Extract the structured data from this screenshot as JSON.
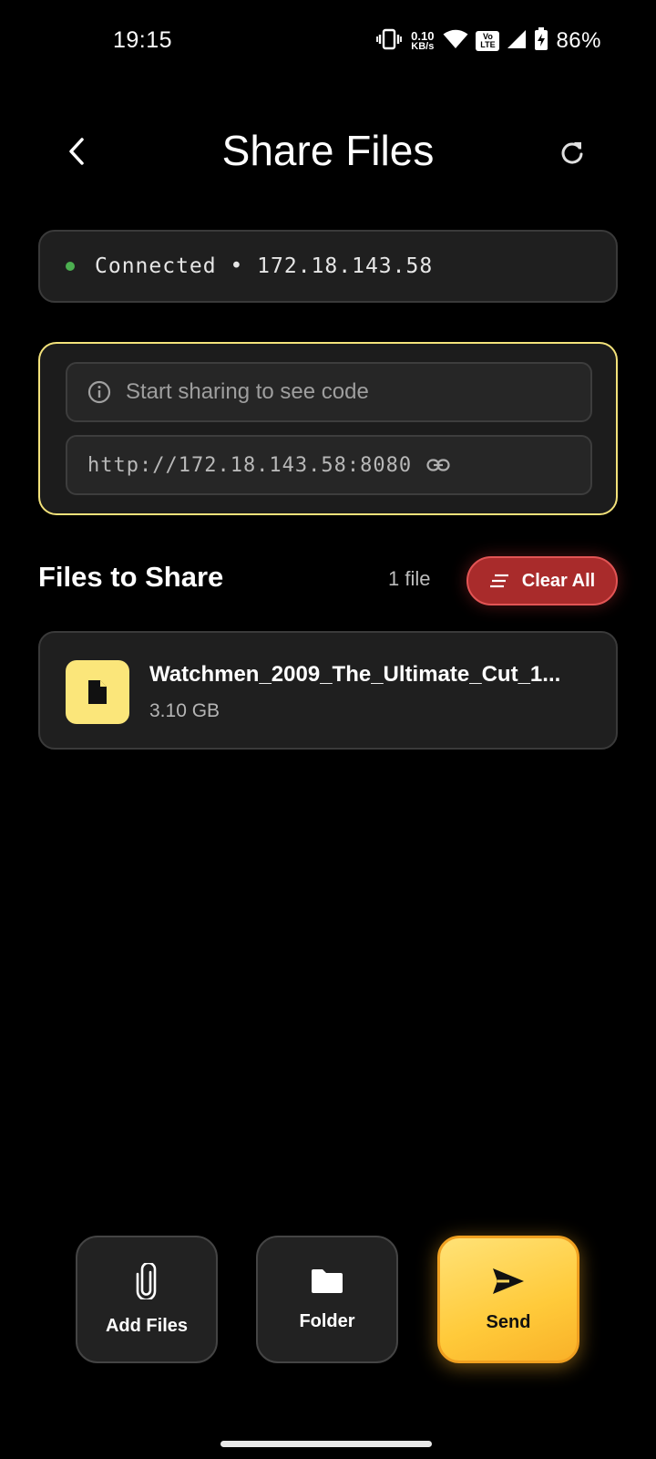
{
  "status_bar": {
    "time": "19:15",
    "net_speed_value": "0.10",
    "net_speed_unit": "KB/s",
    "volte_line1": "Vo",
    "volte_line2": "LTE",
    "battery": "86%",
    "icons": [
      "vibrate-icon",
      "wifi-icon",
      "signal-icon",
      "battery-charging-icon"
    ]
  },
  "header": {
    "title": "Share Files",
    "back_icon": "chevron-left-icon",
    "refresh_icon": "refresh-icon"
  },
  "connection": {
    "status_color": "#4caf50",
    "text": "Connected • 172.18.143.58"
  },
  "share": {
    "code_placeholder": "Start sharing to see code",
    "url": "http://172.18.143.58:8080",
    "accent_color": "#f3e27a"
  },
  "files_section": {
    "title": "Files to Share",
    "count": "1 file",
    "clear_label": "Clear All"
  },
  "files": [
    {
      "name": "Watchmen_2009_The_Ultimate_Cut_1...",
      "size": "3.10 GB",
      "icon": "file-icon"
    }
  ],
  "actions": {
    "add_files": "Add Files",
    "folder": "Folder",
    "send": "Send"
  },
  "colors": {
    "danger": "#a92b2b",
    "send_gradient_start": "#ffe277",
    "send_gradient_end": "#f9b128"
  }
}
